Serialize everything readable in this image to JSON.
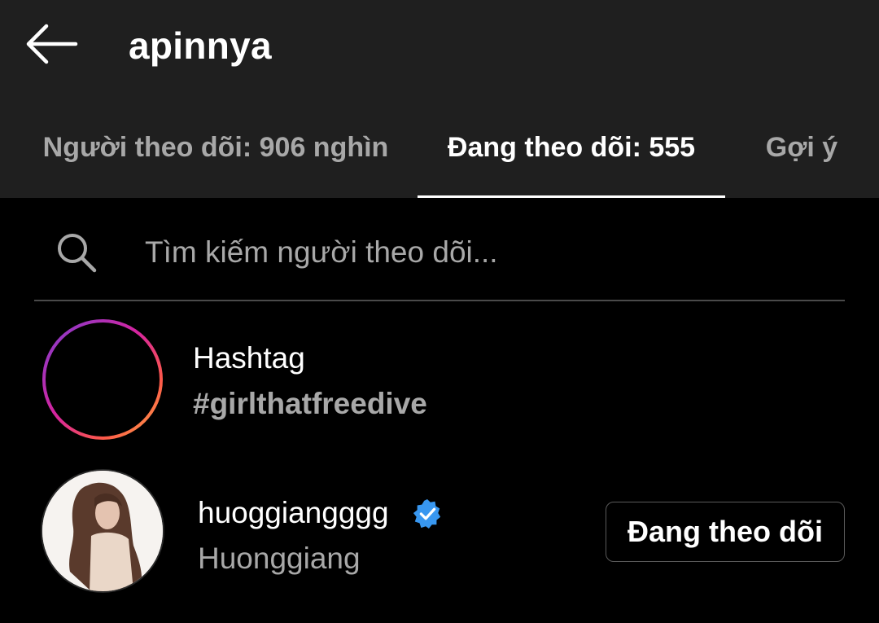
{
  "header": {
    "title": "apinnya"
  },
  "tabs": [
    {
      "label": "Người theo dõi: 906 nghìn",
      "active": false
    },
    {
      "label": "Đang theo dõi: 555",
      "active": true
    },
    {
      "label": "Gợi ý",
      "active": false
    }
  ],
  "search": {
    "placeholder": "Tìm kiếm người theo dõi...",
    "value": ""
  },
  "list": {
    "hashtag": {
      "title": "Hashtag",
      "tag": "#girlthatfreedive",
      "icon": "hashtag-icon"
    },
    "user": {
      "username": "huoggiangggg",
      "display_name": "Huonggiang",
      "verified": true,
      "button_label": "Đang theo dõi"
    }
  },
  "colors": {
    "header_bg": "#1f1f1f",
    "background": "#000000",
    "text_primary": "#ffffff",
    "text_secondary": "#a8a8a8",
    "verified": "#3897f0"
  }
}
